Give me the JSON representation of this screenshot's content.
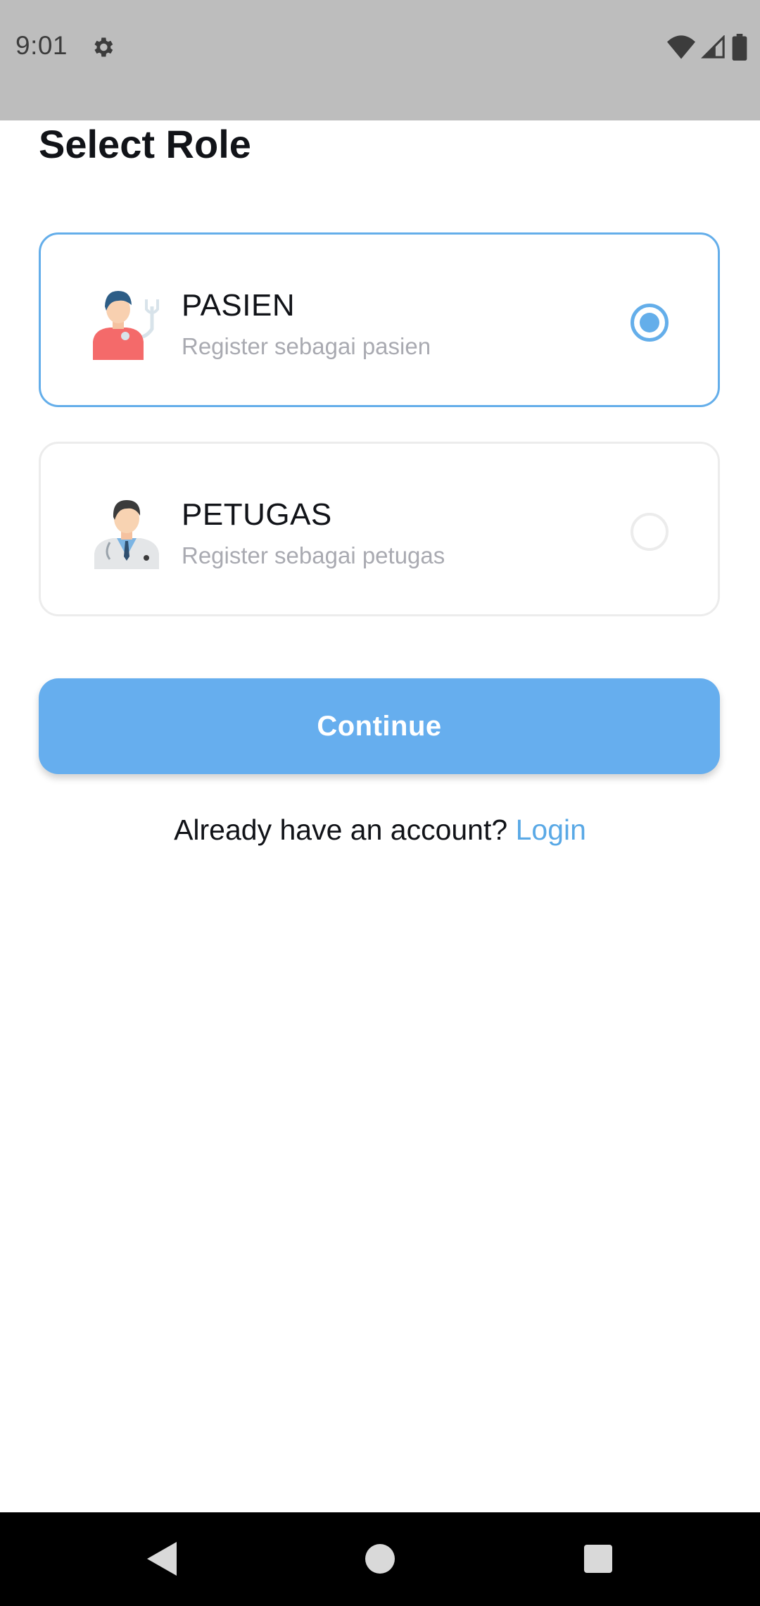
{
  "status_bar": {
    "time": "9:01",
    "icons": [
      "gear-icon",
      "wifi-icon",
      "signal-icon",
      "battery-icon"
    ]
  },
  "title": "Select Role",
  "roles": [
    {
      "title": "PASIEN",
      "subtitle": "Register sebagai pasien",
      "icon": "patient-icon",
      "selected": true
    },
    {
      "title": "PETUGAS",
      "subtitle": "Register sebagai petugas",
      "icon": "doctor-icon",
      "selected": false
    }
  ],
  "continue_label": "Continue",
  "login_prompt": {
    "text": "Already have an account?",
    "link": "Login"
  },
  "colors": {
    "accent": "#64aeea",
    "button": "#66aeee",
    "status_bar": "#bdbdbd"
  },
  "nav_bar": {
    "icons": [
      "back-icon",
      "home-icon",
      "recents-icon"
    ]
  }
}
